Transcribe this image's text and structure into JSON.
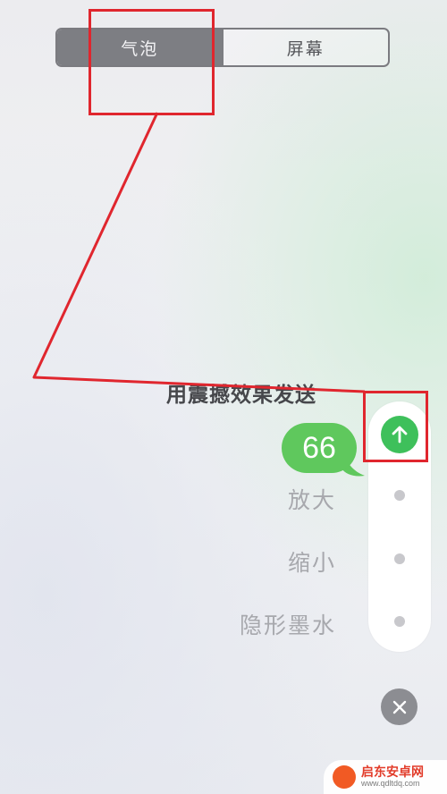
{
  "segment": {
    "bubble_label": "气泡",
    "screen_label": "屏幕"
  },
  "panel": {
    "caption": "用震撼效果发送",
    "message": "66",
    "effects": [
      {
        "label": "放大"
      },
      {
        "label": "缩小"
      },
      {
        "label": "隐形墨水"
      }
    ]
  },
  "watermark": {
    "title": "启东安卓网",
    "url": "www.qdltdq.com"
  },
  "icons": {
    "send": "arrow-up-icon",
    "close": "close-icon"
  },
  "colors": {
    "send_green": "#3ec05b",
    "bubble_green": "#5fc85d",
    "annotation_red": "#e0262e",
    "segment_active": "#7d7e83"
  }
}
